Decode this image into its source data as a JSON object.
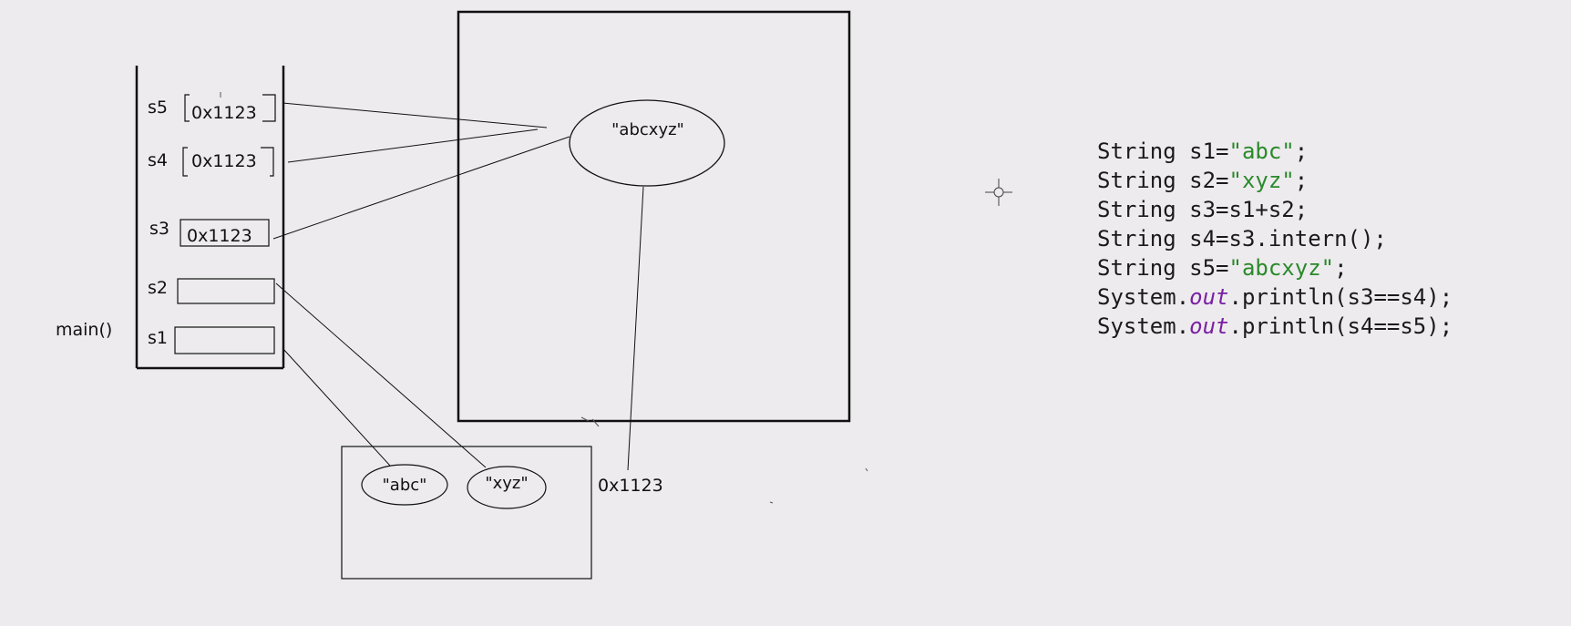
{
  "stack": {
    "frame_label": "main()",
    "slots": [
      {
        "name": "s5",
        "value": "0x1123"
      },
      {
        "name": "s4",
        "value": "0x1123"
      },
      {
        "name": "s3",
        "value": "0x1123"
      },
      {
        "name": "s2",
        "value": ""
      },
      {
        "name": "s1",
        "value": ""
      }
    ]
  },
  "heap": {
    "pool_string": "\"abcxyz\"",
    "address_label": "0x1123"
  },
  "constant_pool": {
    "strings": [
      "\"abc\"",
      "\"xyz\""
    ]
  },
  "code": {
    "lines": [
      [
        {
          "t": "String s1=",
          "k": "plain"
        },
        {
          "t": "\"abc\"",
          "k": "string"
        },
        {
          "t": ";",
          "k": "plain"
        }
      ],
      [
        {
          "t": "String s2=",
          "k": "plain"
        },
        {
          "t": "\"xyz\"",
          "k": "string"
        },
        {
          "t": ";",
          "k": "plain"
        }
      ],
      [
        {
          "t": "String s3=s1+s2;",
          "k": "plain"
        }
      ],
      [
        {
          "t": "String s4=s3.intern();",
          "k": "plain"
        }
      ],
      [
        {
          "t": "String s5=",
          "k": "plain"
        },
        {
          "t": "\"abcxyz\"",
          "k": "string"
        },
        {
          "t": ";",
          "k": "plain"
        }
      ],
      [
        {
          "t": "System.",
          "k": "plain"
        },
        {
          "t": "out",
          "k": "field"
        },
        {
          "t": ".println(s3==s4);",
          "k": "plain"
        }
      ],
      [
        {
          "t": "System.",
          "k": "plain"
        },
        {
          "t": "out",
          "k": "field"
        },
        {
          "t": ".println(s4==s5);",
          "k": "plain"
        }
      ]
    ]
  },
  "colors": {
    "background": "#edebee",
    "stroke": "#111111",
    "string_literal": "#2a8a2a",
    "static_field": "#7a1fa2"
  }
}
